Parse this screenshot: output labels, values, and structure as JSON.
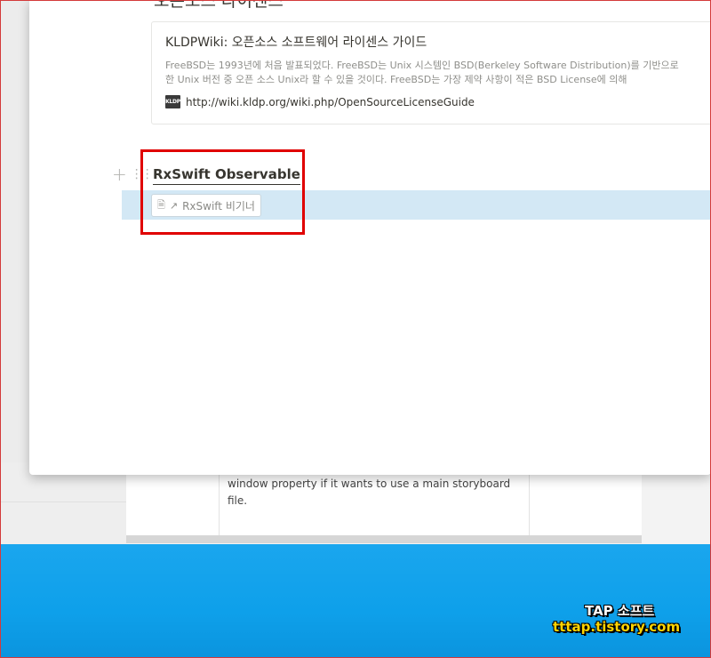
{
  "background_window": {
    "text": "window property if it wants to use a main storyboard file."
  },
  "modal": {
    "section_heading": "오픈소스 라이센스",
    "bookmark": {
      "title": "KLDPWiki: 오픈소스 소프트웨어 라이센스 가이드",
      "description_line1": "FreeBSD는 1993년에 처음 발표되었다. FreeBSD는 Unix 시스템인 BSD(Berkeley Software Distribution)를 기반으로",
      "description_line2": "한 Unix 버전 중 오픈 소스 Unix라 할 수 있을 것이다. FreeBSD는 가장 제약 사항이 적은 BSD License에 의해",
      "favicon_text": "KLDP",
      "url": "http://wiki.kldp.org/wiki.php/OpenSourceLicenseGuide"
    },
    "block": {
      "title": "RxSwift Observable",
      "page_link": "RxSwift 비기너"
    }
  },
  "watermark": {
    "line1": "TAP 소프트",
    "line2": "tttap.tistory.com"
  },
  "colors": {
    "highlight_box": "#e00000",
    "selection": "#d3e8f5",
    "desktop": "#0ea0ea"
  }
}
